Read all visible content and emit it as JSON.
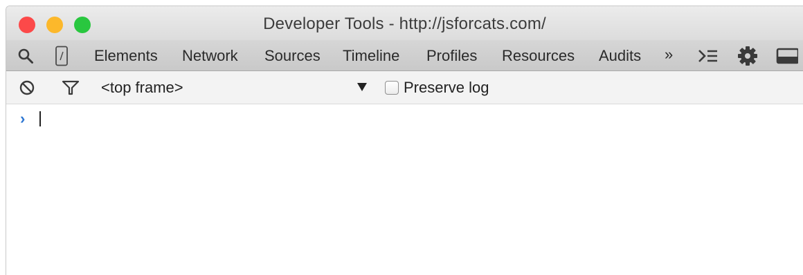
{
  "window": {
    "title": "Developer Tools - http://jsforcats.com/"
  },
  "toolbar": {
    "tabs": [
      {
        "label": "Elements"
      },
      {
        "label": "Network"
      },
      {
        "label": "Sources"
      },
      {
        "label": "Timeline"
      },
      {
        "label": "Profiles"
      },
      {
        "label": "Resources"
      },
      {
        "label": "Audits"
      }
    ],
    "overflow_label": "»",
    "icons": [
      "search-icon",
      "device-mode-icon",
      "console-drawer-icon",
      "gear-icon",
      "dock-icon"
    ]
  },
  "console": {
    "frame_selector": "<top frame>",
    "preserve_log_label": "Preserve log",
    "preserve_log_checked": false,
    "prompt_symbol": "›",
    "icons": [
      "clear-console-icon",
      "filter-icon",
      "dropdown-arrow-icon"
    ]
  },
  "colors": {
    "close": "#fc4949",
    "minimize": "#fcb82b",
    "zoom": "#29c73f",
    "prompt": "#2d76d2"
  }
}
